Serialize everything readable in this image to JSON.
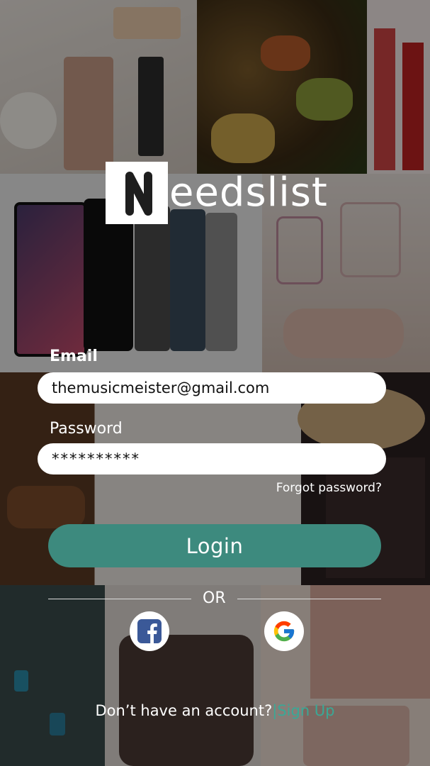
{
  "app": {
    "logo_text": "eedslist"
  },
  "form": {
    "email_label": "Email",
    "email_value": "themusicmeister@gmail.com",
    "password_label": "Password",
    "password_value": "**********",
    "forgot_label": "Forgot password?",
    "login_label": "Login"
  },
  "divider": {
    "or_label": "OR"
  },
  "social": {
    "facebook_icon": "facebook-icon",
    "google_icon": "google-icon"
  },
  "footer": {
    "question": "Don’t have an account?",
    "separator": "|",
    "signup_label": "Sign Up"
  },
  "colors": {
    "accent": "#3d8a7e",
    "link": "#3aa896",
    "facebook": "#3b5998"
  }
}
